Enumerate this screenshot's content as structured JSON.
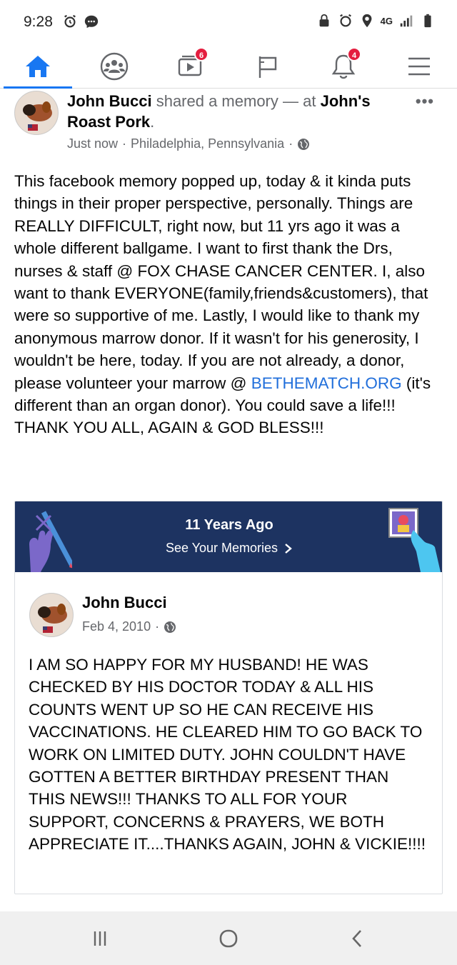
{
  "status_bar": {
    "time": "9:28",
    "network": "4G"
  },
  "nav": {
    "items": [
      {
        "icon": "home-icon",
        "active": true
      },
      {
        "icon": "groups-icon"
      },
      {
        "icon": "watch-icon",
        "badge": "6"
      },
      {
        "icon": "pages-flag-icon"
      },
      {
        "icon": "notifications-bell-icon",
        "badge": "4"
      },
      {
        "icon": "menu-icon"
      }
    ],
    "accent": "#1877f2",
    "badge_color": "#e41e3f"
  },
  "post": {
    "author": "John Bucci",
    "action": "shared a memory — at",
    "place": "John's Roast Pork",
    "time": "Just now",
    "location": "Philadelphia, Pennsylvania",
    "text_before_link": "This facebook memory popped up, today & it kinda puts things in their proper perspective, personally. Things are REALLY DIFFICULT, right now, but 11 yrs ago it was a whole different ballgame. I want to first thank the Drs, nurses & staff @ FOX CHASE CANCER CENTER. I, also want to thank EVERYONE(family,friends&customers), that were so supportive of me. Lastly, I would like to thank my anonymous marrow donor. If it wasn't for his generosity, I wouldn't be here, today. If you are not already, a donor, please volunteer your marrow @ ",
    "link": "BETHEMATCH.ORG",
    "text_after_link": " (it's different than an organ donor). You could save a life!!! THANK YOU ALL, AGAIN & GOD BLESS!!!",
    "link_color": "#216fdb"
  },
  "memory": {
    "title": "11 Years Ago",
    "subtitle": "See Your Memories",
    "banner_color": "#1d3361",
    "original_post": {
      "author": "John Bucci",
      "date": "Feb 4, 2010",
      "text": "I AM SO HAPPY FOR MY HUSBAND!  HE WAS CHECKED BY HIS DOCTOR TODAY & ALL HIS COUNTS WENT UP SO HE CAN RECEIVE HIS VACCINATIONS. HE CLEARED HIM TO GO BACK TO WORK ON LIMITED DUTY.  JOHN COULDN'T HAVE GOTTEN A BETTER BIRTHDAY PRESENT THAN THIS NEWS!!!  THANKS TO ALL FOR YOUR SUPPORT, CONCERNS & PRAYERS, WE BOTH APPRECIATE IT....THANKS AGAIN, JOHN & VICKIE!!!!"
    }
  },
  "android_nav": {
    "items": [
      "recent-apps-icon",
      "home-circle-icon",
      "back-icon"
    ]
  }
}
